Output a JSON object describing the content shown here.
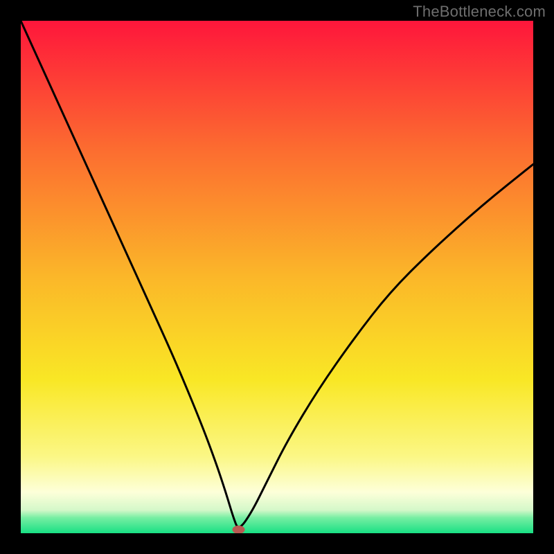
{
  "watermark": "TheBottleneck.com",
  "chart_data": {
    "type": "line",
    "title": "",
    "xlabel": "",
    "ylabel": "",
    "xlim": [
      0,
      100
    ],
    "ylim": [
      0,
      100
    ],
    "grid": false,
    "legend": false,
    "background_gradient": {
      "stops": [
        {
          "offset": 0.0,
          "color": "#fe163b"
        },
        {
          "offset": 0.25,
          "color": "#fc6c30"
        },
        {
          "offset": 0.5,
          "color": "#fbb729"
        },
        {
          "offset": 0.7,
          "color": "#f9e725"
        },
        {
          "offset": 0.85,
          "color": "#fbf785"
        },
        {
          "offset": 0.92,
          "color": "#fdffd9"
        },
        {
          "offset": 0.955,
          "color": "#d4f8c9"
        },
        {
          "offset": 0.97,
          "color": "#76eea2"
        },
        {
          "offset": 1.0,
          "color": "#18e084"
        }
      ]
    },
    "series": [
      {
        "name": "bottleneck-curve",
        "color": "#000000",
        "x": [
          0,
          5,
          10,
          15,
          20,
          25,
          30,
          35,
          38,
          40,
          41.5,
          42.5,
          45,
          48,
          52,
          58,
          65,
          72,
          80,
          90,
          100
        ],
        "values": [
          100,
          89,
          78,
          67,
          56,
          45,
          34,
          22,
          14,
          8,
          3,
          0.5,
          4,
          10,
          18,
          28,
          38,
          47,
          55,
          64,
          72
        ]
      }
    ],
    "marker": {
      "name": "optimal-point",
      "x": 42.5,
      "y": 0.7,
      "color": "#b95a52",
      "rx": 9,
      "ry": 6
    }
  }
}
